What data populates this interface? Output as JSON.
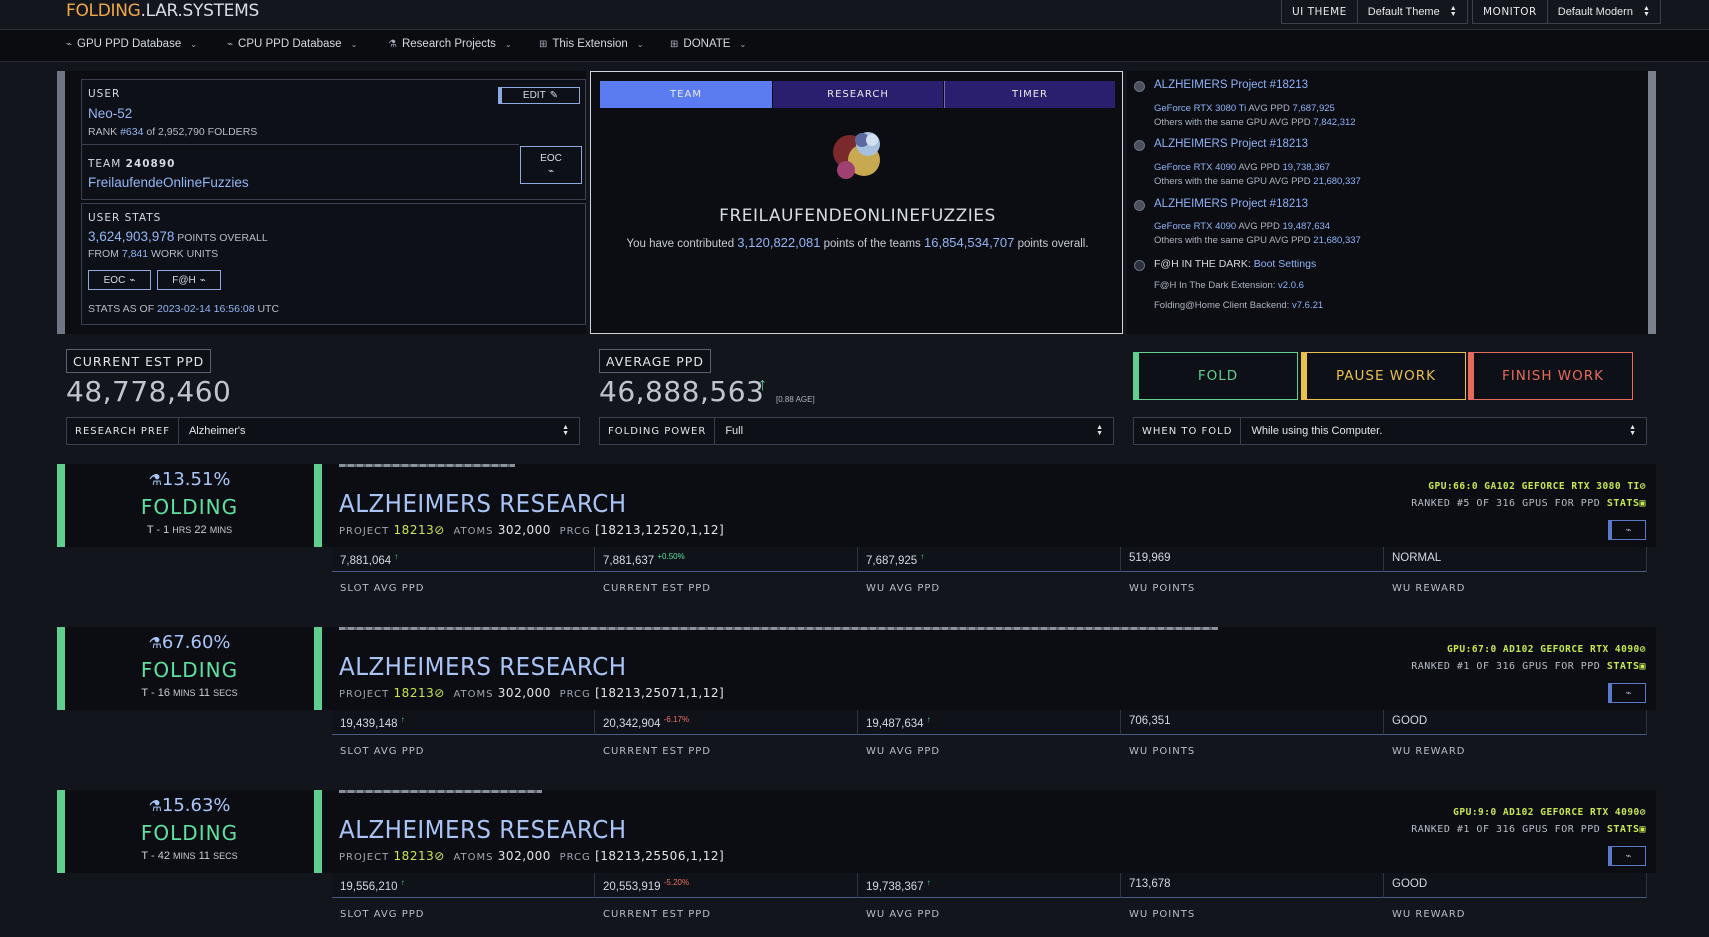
{
  "brand": {
    "part1": "FOLDING",
    "part2": ".LAR.SYSTEMS"
  },
  "top": {
    "theme_label": "UI THEME",
    "theme_value": "Default Theme",
    "monitor_label": "MONITOR",
    "monitor_value": "Default Modern"
  },
  "nav": [
    {
      "label": "GPU PPD Database",
      "icon": "chart-icon"
    },
    {
      "label": "CPU PPD Database",
      "icon": "chart-icon"
    },
    {
      "label": "Research Projects",
      "icon": "flask-icon"
    },
    {
      "label": "This Extension",
      "icon": "grid-icon"
    },
    {
      "label": "DONATE",
      "icon": "grid-icon"
    }
  ],
  "user": {
    "label": "USER",
    "edit": "EDIT",
    "name": "Neo-52",
    "rank_prefix": "RANK ",
    "rank": "#634",
    "rank_mid": " of ",
    "rank_total": "2,952,790",
    "rank_suffix": " FOLDERS",
    "team_label": "TEAM",
    "team_id": "240890",
    "team_name": "FreilaufendeOnlineFuzzies",
    "eoc": "EOC"
  },
  "user_stats": {
    "label": "USER STATS",
    "points": "3,624,903,978",
    "points_suffix": " POINTS OVERALL",
    "from_prefix": "FROM ",
    "wus": "7,841",
    "wus_suffix": " WORK UNITS",
    "eoc": "EOC",
    "fah": "F@H",
    "asof_prefix": "STATS AS OF ",
    "asof": "2023-02-14 16:56:08",
    "asof_suffix": " UTC"
  },
  "center": {
    "tabs": [
      "TEAM",
      "RESEARCH",
      "TIMER"
    ],
    "team_name": "FREILAUFENDEONLINEFUZZIES",
    "contrib_prefix": "You have contributed ",
    "contrib": "3,120,822,081",
    "contrib_mid": " points of the teams ",
    "team_total": "16,854,534,707",
    "contrib_suffix": " points overall."
  },
  "recent": [
    {
      "project": "ALZHEIMERS Project #18213",
      "gpu": "GeForce RTX 3080 Ti",
      "avg_label": " AVG PPD ",
      "avg": "7,687,925",
      "others_label": "Others with the same GPU AVG PPD ",
      "others": "7,842,312"
    },
    {
      "project": "ALZHEIMERS Project #18213",
      "gpu": "GeForce RTX 4090",
      "avg_label": " AVG PPD ",
      "avg": "19,738,367",
      "others_label": "Others with the same GPU AVG PPD ",
      "others": "21,680,337"
    },
    {
      "project": "ALZHEIMERS Project #18213",
      "gpu": "GeForce RTX 4090",
      "avg_label": " AVG PPD ",
      "avg": "19,487,634",
      "others_label": "Others with the same GPU AVG PPD ",
      "others": "21,680,337"
    }
  ],
  "dark": {
    "label": "F@H IN THE DARK: ",
    "link": "Boot Settings",
    "ext_label": "F@H In The Dark Extension: ",
    "ext_ver": "v2.0.6",
    "backend_label": "Folding@Home Client Backend: ",
    "backend_ver": "v7.6.21"
  },
  "ppd": {
    "current_label": "CURRENT EST PPD",
    "current": "48,778,460",
    "avg_label": "AVERAGE PPD",
    "avg": "46,888,563",
    "age": "[0.88 AGE]"
  },
  "actions": {
    "fold": "FOLD",
    "pause": "PAUSE WORK",
    "finish": "FINISH WORK"
  },
  "prefs": {
    "research_label": "RESEARCH PREF",
    "research_value": "Alzheimer's",
    "power_label": "FOLDING POWER",
    "power_value": "Full",
    "when_label": "WHEN TO FOLD",
    "when_value": "While using this Computer."
  },
  "slot_labels": {
    "project": "PROJECT",
    "atoms": "ATOMS",
    "prcg": "PRCG",
    "ranked_prefix": "RANKED ",
    "ranked_suffix": " GPUS FOR PPD ",
    "stats": "STATS",
    "slot_avg": "SLOT AVG PPD",
    "current_est": "CURRENT EST PPD",
    "wu_avg": "WU AVG PPD",
    "wu_points": "WU POINTS",
    "wu_reward": "WU REWARD",
    "t_prefix": "T - "
  },
  "slots": [
    {
      "pct": "13.51%",
      "progress": 0.1351,
      "status": "FOLDING",
      "t1": "1",
      "u1": "HRS",
      "t2": "22",
      "u2": "MINS",
      "title": "ALZHEIMERS RESEARCH",
      "project": "18213",
      "atoms": "302,000",
      "prcg": "[18213,12520,1,12]",
      "gpu": "GPU:66:0 GA102 GEFORCE RTX 3080 TI",
      "rank": "#5 OF 316",
      "slot_avg": "7,881,064",
      "slot_avg_d": "↑",
      "cur_est": "7,881,637",
      "cur_est_d": "+0.50%",
      "cur_est_color": "#5ee0a0",
      "wu_avg": "7,687,925",
      "wu_avg_d": "↑",
      "wu_points": "519,969",
      "wu_reward": "NORMAL"
    },
    {
      "pct": "67.60%",
      "progress": 0.676,
      "status": "FOLDING",
      "t1": "16",
      "u1": "MINS",
      "t2": "11",
      "u2": "SECS",
      "title": "ALZHEIMERS RESEARCH",
      "project": "18213",
      "atoms": "302,000",
      "prcg": "[18213,25071,1,12]",
      "gpu": "GPU:67:0 AD102 GEFORCE RTX 4090",
      "rank": "#1 OF 316",
      "slot_avg": "19,439,148",
      "slot_avg_d": "↑",
      "cur_est": "20,342,904",
      "cur_est_d": "-6.17%",
      "cur_est_color": "#f07060",
      "wu_avg": "19,487,634",
      "wu_avg_d": "↑",
      "wu_points": "706,351",
      "wu_reward": "GOOD"
    },
    {
      "pct": "15.63%",
      "progress": 0.1563,
      "status": "FOLDING",
      "t1": "42",
      "u1": "MINS",
      "t2": "11",
      "u2": "SECS",
      "title": "ALZHEIMERS RESEARCH",
      "project": "18213",
      "atoms": "302,000",
      "prcg": "[18213,25506,1,12]",
      "gpu": "GPU:9:0 AD102 GEFORCE RTX 4090",
      "rank": "#1 OF 316",
      "slot_avg": "19,556,210",
      "slot_avg_d": "↑",
      "cur_est": "20,553,919",
      "cur_est_d": "-5.20%",
      "cur_est_color": "#f07060",
      "wu_avg": "19,738,367",
      "wu_avg_d": "↑",
      "wu_points": "713,678",
      "wu_reward": "GOOD"
    }
  ],
  "colors": {
    "accent": "#5b7cf0",
    "fold": "#5ecf8f",
    "pause": "#e8c04a",
    "finish": "#e86a5a",
    "lime": "#c6e84c"
  }
}
